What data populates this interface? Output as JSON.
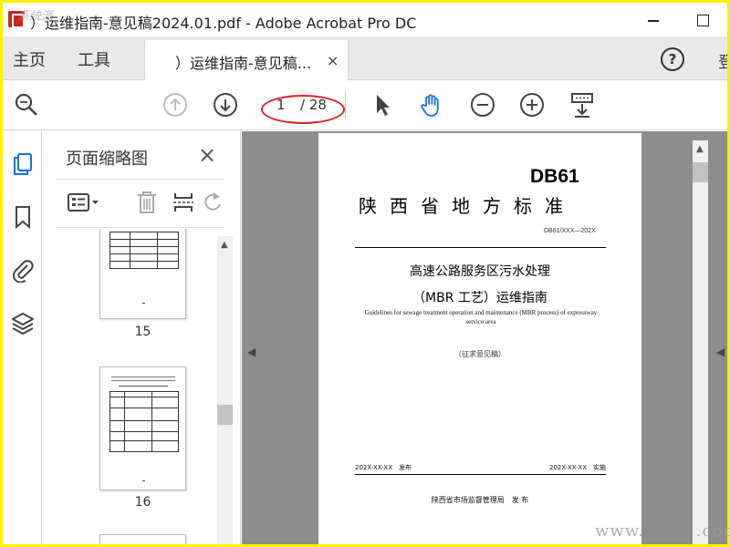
{
  "window": {
    "title": "）运维指南-意见稿2024.01.pdf - Adobe Acrobat Pro DC",
    "watermark_top": "系统派"
  },
  "menu": {
    "home": "主页",
    "tools": "工具",
    "tab_label": "）运维指南-意见稿...",
    "tab_close": "×",
    "help": "?",
    "signin": "登"
  },
  "toolbar": {
    "current_page": "1",
    "total_pages": "/ 28",
    "icons": [
      "search-zoom",
      "page-up",
      "page-down",
      "select-pointer",
      "hand-tool",
      "zoom-out",
      "zoom-in",
      "fit-page"
    ],
    "hand_color": "#1473e6"
  },
  "panel": {
    "title": "页面缩略图",
    "close": "×",
    "thumbnails": [
      {
        "label": "15"
      },
      {
        "label": "16"
      }
    ]
  },
  "document": {
    "code_logo": "DB61",
    "standard_title": "陕西省地方标准",
    "standard_number": "DB61/XXX—202X",
    "title_line1": "高速公路服务区污水处理",
    "title_line2": "（MBR 工艺）运维指南",
    "title_english": "Guidelines for sewage treatment operation and maintenance (MBR process) of expressway service area",
    "draft_note": "（征求意见稿）",
    "publish_date": "202X-XX-XX　发布",
    "implement_date": "202X-XX-XX　实施",
    "issuer": "陕西省市场监督管理局　发 布"
  },
  "watermark_bottom": "www.　　　.com",
  "colors": {
    "frame": "#ffef00",
    "annotation_red": "#d8262b",
    "app_red": "#c8261e"
  }
}
